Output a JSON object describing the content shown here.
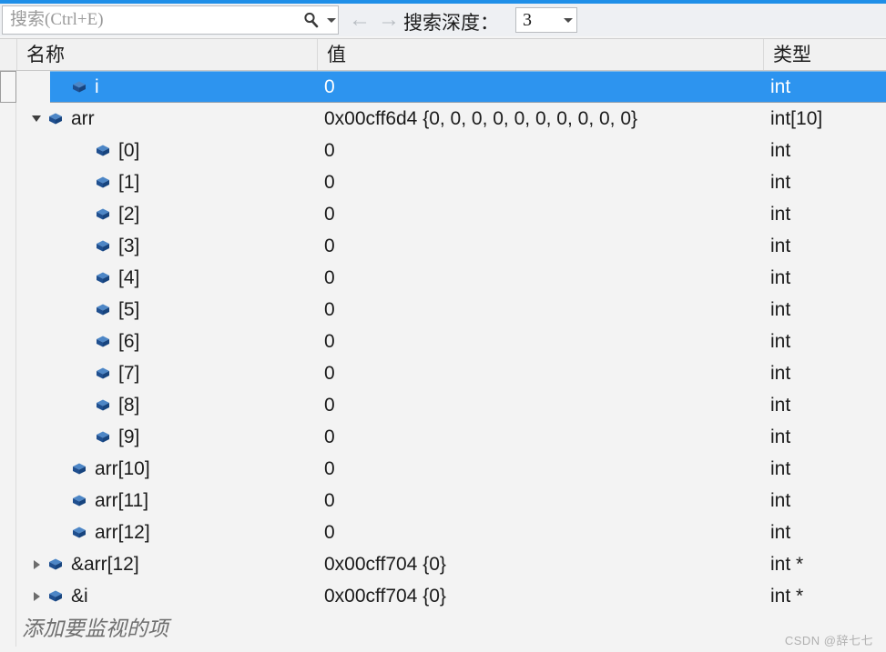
{
  "toolbar": {
    "search_placeholder": "搜索(Ctrl+E)",
    "search_value": "",
    "search_icon": "search-icon",
    "search_dropdown_icon": "chevron-down-icon",
    "back_arrow": "←",
    "forward_arrow": "→",
    "depth_label": "搜索深度：",
    "depth_value": "3",
    "depth_dropdown_icon": "chevron-down-icon"
  },
  "grid": {
    "columns": [
      "名称",
      "值",
      "类型"
    ],
    "rows": [
      {
        "indent": 1,
        "twisty": "none",
        "name": "i",
        "value": "0",
        "type": "int",
        "selected": true
      },
      {
        "indent": 0,
        "twisty": "expanded",
        "name": "arr",
        "value": "0x00cff6d4 {0, 0, 0, 0, 0, 0, 0, 0, 0, 0}",
        "type": "int[10]",
        "selected": false
      },
      {
        "indent": 2,
        "twisty": "none",
        "name": "[0]",
        "value": "0",
        "type": "int",
        "selected": false
      },
      {
        "indent": 2,
        "twisty": "none",
        "name": "[1]",
        "value": "0",
        "type": "int",
        "selected": false
      },
      {
        "indent": 2,
        "twisty": "none",
        "name": "[2]",
        "value": "0",
        "type": "int",
        "selected": false
      },
      {
        "indent": 2,
        "twisty": "none",
        "name": "[3]",
        "value": "0",
        "type": "int",
        "selected": false
      },
      {
        "indent": 2,
        "twisty": "none",
        "name": "[4]",
        "value": "0",
        "type": "int",
        "selected": false
      },
      {
        "indent": 2,
        "twisty": "none",
        "name": "[5]",
        "value": "0",
        "type": "int",
        "selected": false
      },
      {
        "indent": 2,
        "twisty": "none",
        "name": "[6]",
        "value": "0",
        "type": "int",
        "selected": false
      },
      {
        "indent": 2,
        "twisty": "none",
        "name": "[7]",
        "value": "0",
        "type": "int",
        "selected": false
      },
      {
        "indent": 2,
        "twisty": "none",
        "name": "[8]",
        "value": "0",
        "type": "int",
        "selected": false
      },
      {
        "indent": 2,
        "twisty": "none",
        "name": "[9]",
        "value": "0",
        "type": "int",
        "selected": false
      },
      {
        "indent": 1,
        "twisty": "none",
        "name": "arr[10]",
        "value": "0",
        "type": "int",
        "selected": false
      },
      {
        "indent": 1,
        "twisty": "none",
        "name": "arr[11]",
        "value": "0",
        "type": "int",
        "selected": false
      },
      {
        "indent": 1,
        "twisty": "none",
        "name": "arr[12]",
        "value": "0",
        "type": "int",
        "selected": false
      },
      {
        "indent": 0,
        "twisty": "collapsed",
        "name": "&arr[12]",
        "value": "0x00cff704 {0}",
        "type": "int *",
        "selected": false
      },
      {
        "indent": 0,
        "twisty": "collapsed",
        "name": "&i",
        "value": "0x00cff704 {0}",
        "type": "int *",
        "selected": false
      }
    ],
    "add_item_placeholder": "添加要监视的项"
  },
  "watermark": "CSDN @辞七七",
  "colors": {
    "accent": "#1f8fe8",
    "selection": "#2d94ef",
    "icon_blue": "#1f5fa9",
    "toolbar_bg": "#eef0f3",
    "grid_bg": "#f3f3f3"
  }
}
